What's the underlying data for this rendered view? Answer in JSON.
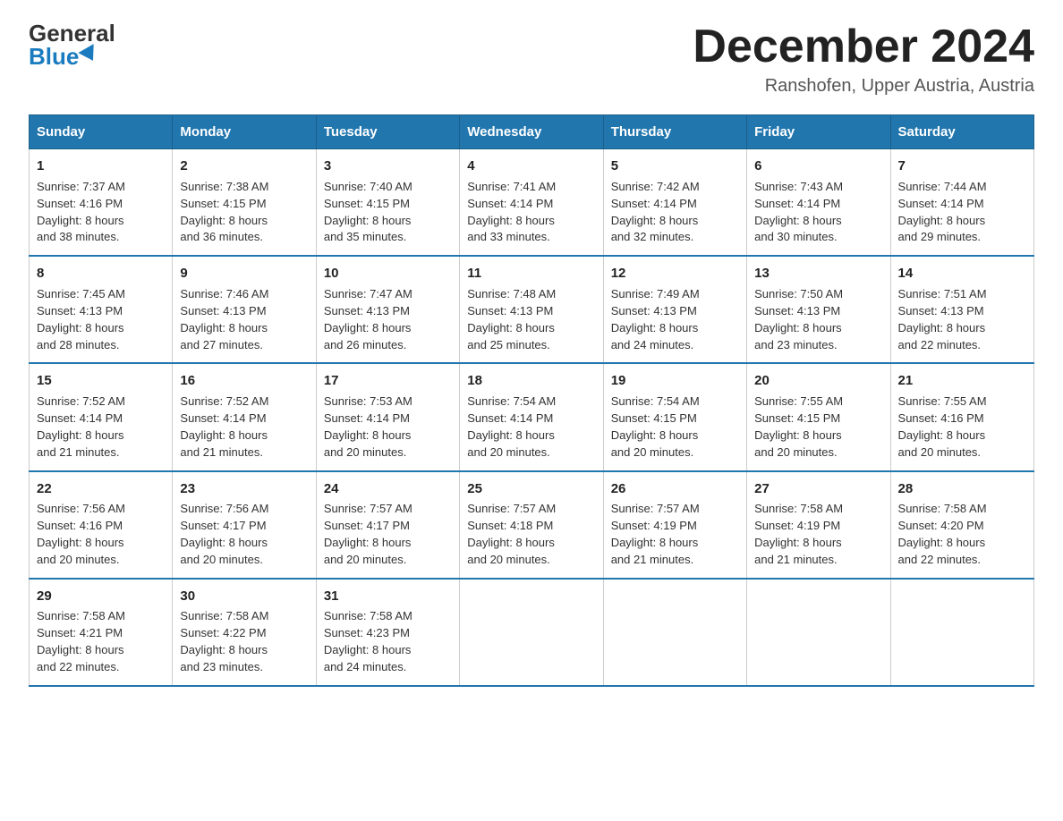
{
  "logo": {
    "general": "General",
    "blue": "Blue"
  },
  "title": "December 2024",
  "location": "Ranshofen, Upper Austria, Austria",
  "headers": [
    "Sunday",
    "Monday",
    "Tuesday",
    "Wednesday",
    "Thursday",
    "Friday",
    "Saturday"
  ],
  "weeks": [
    [
      {
        "day": "1",
        "sunrise": "7:37 AM",
        "sunset": "4:16 PM",
        "daylight": "8 hours and 38 minutes."
      },
      {
        "day": "2",
        "sunrise": "7:38 AM",
        "sunset": "4:15 PM",
        "daylight": "8 hours and 36 minutes."
      },
      {
        "day": "3",
        "sunrise": "7:40 AM",
        "sunset": "4:15 PM",
        "daylight": "8 hours and 35 minutes."
      },
      {
        "day": "4",
        "sunrise": "7:41 AM",
        "sunset": "4:14 PM",
        "daylight": "8 hours and 33 minutes."
      },
      {
        "day": "5",
        "sunrise": "7:42 AM",
        "sunset": "4:14 PM",
        "daylight": "8 hours and 32 minutes."
      },
      {
        "day": "6",
        "sunrise": "7:43 AM",
        "sunset": "4:14 PM",
        "daylight": "8 hours and 30 minutes."
      },
      {
        "day": "7",
        "sunrise": "7:44 AM",
        "sunset": "4:14 PM",
        "daylight": "8 hours and 29 minutes."
      }
    ],
    [
      {
        "day": "8",
        "sunrise": "7:45 AM",
        "sunset": "4:13 PM",
        "daylight": "8 hours and 28 minutes."
      },
      {
        "day": "9",
        "sunrise": "7:46 AM",
        "sunset": "4:13 PM",
        "daylight": "8 hours and 27 minutes."
      },
      {
        "day": "10",
        "sunrise": "7:47 AM",
        "sunset": "4:13 PM",
        "daylight": "8 hours and 26 minutes."
      },
      {
        "day": "11",
        "sunrise": "7:48 AM",
        "sunset": "4:13 PM",
        "daylight": "8 hours and 25 minutes."
      },
      {
        "day": "12",
        "sunrise": "7:49 AM",
        "sunset": "4:13 PM",
        "daylight": "8 hours and 24 minutes."
      },
      {
        "day": "13",
        "sunrise": "7:50 AM",
        "sunset": "4:13 PM",
        "daylight": "8 hours and 23 minutes."
      },
      {
        "day": "14",
        "sunrise": "7:51 AM",
        "sunset": "4:13 PM",
        "daylight": "8 hours and 22 minutes."
      }
    ],
    [
      {
        "day": "15",
        "sunrise": "7:52 AM",
        "sunset": "4:14 PM",
        "daylight": "8 hours and 21 minutes."
      },
      {
        "day": "16",
        "sunrise": "7:52 AM",
        "sunset": "4:14 PM",
        "daylight": "8 hours and 21 minutes."
      },
      {
        "day": "17",
        "sunrise": "7:53 AM",
        "sunset": "4:14 PM",
        "daylight": "8 hours and 20 minutes."
      },
      {
        "day": "18",
        "sunrise": "7:54 AM",
        "sunset": "4:14 PM",
        "daylight": "8 hours and 20 minutes."
      },
      {
        "day": "19",
        "sunrise": "7:54 AM",
        "sunset": "4:15 PM",
        "daylight": "8 hours and 20 minutes."
      },
      {
        "day": "20",
        "sunrise": "7:55 AM",
        "sunset": "4:15 PM",
        "daylight": "8 hours and 20 minutes."
      },
      {
        "day": "21",
        "sunrise": "7:55 AM",
        "sunset": "4:16 PM",
        "daylight": "8 hours and 20 minutes."
      }
    ],
    [
      {
        "day": "22",
        "sunrise": "7:56 AM",
        "sunset": "4:16 PM",
        "daylight": "8 hours and 20 minutes."
      },
      {
        "day": "23",
        "sunrise": "7:56 AM",
        "sunset": "4:17 PM",
        "daylight": "8 hours and 20 minutes."
      },
      {
        "day": "24",
        "sunrise": "7:57 AM",
        "sunset": "4:17 PM",
        "daylight": "8 hours and 20 minutes."
      },
      {
        "day": "25",
        "sunrise": "7:57 AM",
        "sunset": "4:18 PM",
        "daylight": "8 hours and 20 minutes."
      },
      {
        "day": "26",
        "sunrise": "7:57 AM",
        "sunset": "4:19 PM",
        "daylight": "8 hours and 21 minutes."
      },
      {
        "day": "27",
        "sunrise": "7:58 AM",
        "sunset": "4:19 PM",
        "daylight": "8 hours and 21 minutes."
      },
      {
        "day": "28",
        "sunrise": "7:58 AM",
        "sunset": "4:20 PM",
        "daylight": "8 hours and 22 minutes."
      }
    ],
    [
      {
        "day": "29",
        "sunrise": "7:58 AM",
        "sunset": "4:21 PM",
        "daylight": "8 hours and 22 minutes."
      },
      {
        "day": "30",
        "sunrise": "7:58 AM",
        "sunset": "4:22 PM",
        "daylight": "8 hours and 23 minutes."
      },
      {
        "day": "31",
        "sunrise": "7:58 AM",
        "sunset": "4:23 PM",
        "daylight": "8 hours and 24 minutes."
      },
      null,
      null,
      null,
      null
    ]
  ],
  "labels": {
    "sunrise": "Sunrise:",
    "sunset": "Sunset:",
    "daylight": "Daylight:"
  }
}
